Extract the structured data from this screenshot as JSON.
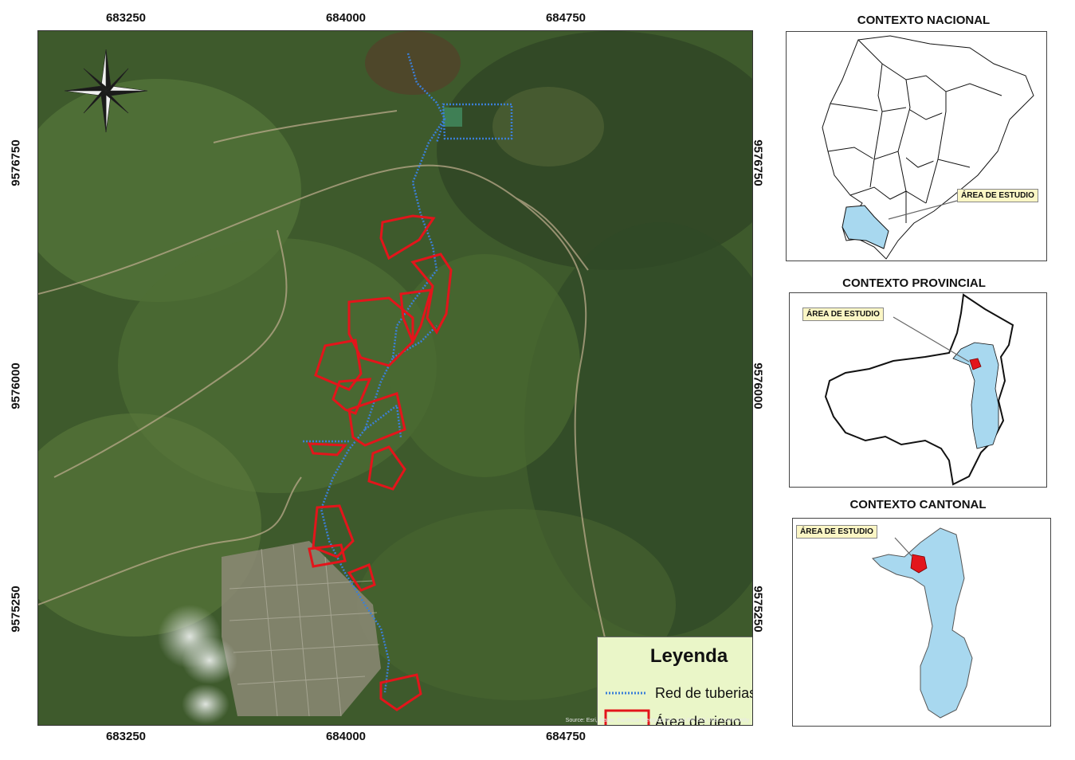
{
  "main_map": {
    "x_ticks": [
      "683250",
      "684000",
      "684750"
    ],
    "y_ticks": [
      "9576750",
      "9576000",
      "9575250"
    ],
    "attribution": "Source: Esri, Maxar, Earthstar Geographics, and the GIS User Community",
    "legend": {
      "title": "Leyenda",
      "items": [
        {
          "label": "Red de tuberias",
          "symbol": "dotted-blue-line",
          "color": "#3b7fd8"
        },
        {
          "label": "Área de riego",
          "symbol": "red-outline-polygon",
          "color": "#e3151b"
        }
      ]
    },
    "north_arrow": "compass-rose-icon"
  },
  "insets": {
    "national": {
      "title": "CONTEXTO NACIONAL",
      "callout": "ÁREA DE ESTUDIO"
    },
    "provincial": {
      "title": "CONTEXTO PROVINCIAL",
      "callout": "ÁREA DE ESTUDIO"
    },
    "cantonal": {
      "title": "CONTEXTO CANTONAL",
      "callout": "ÁREA DE ESTUDIO"
    }
  },
  "colors": {
    "study_area_fill": "#a8d8ef",
    "irrigation_outline": "#e3151b",
    "pipeline": "#3b7fd8",
    "legend_bg": "#eaf6c8",
    "callout_bg": "#fbf6c5"
  }
}
